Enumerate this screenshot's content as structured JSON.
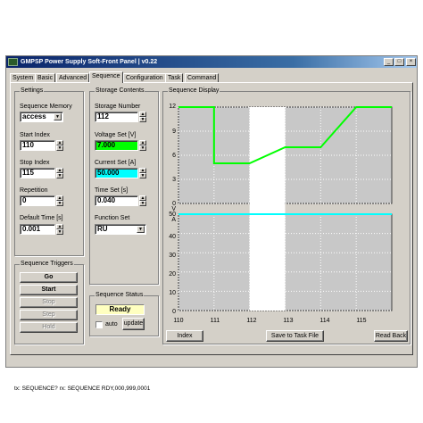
{
  "window": {
    "title": "GMPSP Power Supply Soft-Front Panel | v0.22",
    "controls": [
      "_",
      "□",
      "×"
    ]
  },
  "tabs": [
    {
      "label": "System",
      "active": false
    },
    {
      "label": "Basic",
      "active": false
    },
    {
      "label": "Advanced",
      "active": false
    },
    {
      "label": "Sequence",
      "active": true
    },
    {
      "label": "Configuration",
      "active": false
    },
    {
      "label": "Task",
      "active": false
    },
    {
      "label": "Command",
      "active": false
    }
  ],
  "settings": {
    "group_label": "Settings",
    "sequence_memory": {
      "label": "Sequence Memory",
      "value": "access"
    },
    "start_index": {
      "label": "Start Index",
      "value": "110"
    },
    "stop_index": {
      "label": "Stop Index",
      "value": "115"
    },
    "repetition": {
      "label": "Repetition",
      "value": "0"
    },
    "default_time": {
      "label": "Default Time [s]",
      "value": "0.001"
    }
  },
  "triggers": {
    "group_label": "Sequence Triggers",
    "go": "Go",
    "start": "Start",
    "stop": "Stop",
    "step": "Step",
    "hold": "Hold"
  },
  "storage": {
    "group_label": "Storage Contents",
    "storage_number": {
      "label": "Storage Number",
      "value": "112"
    },
    "voltage_set": {
      "label": "Voltage Set [V]",
      "value": "7.000",
      "color": "#00ff00"
    },
    "current_set": {
      "label": "Current Set [A]",
      "value": "50.000",
      "color": "#00ffff"
    },
    "time_set": {
      "label": "Time Set [s]",
      "value": "0.040"
    },
    "function_set": {
      "label": "Function Set",
      "value": "RU"
    }
  },
  "seq_status": {
    "group_label": "Sequence Status",
    "state": "Ready",
    "state_color": "#ffffc0",
    "auto_label": "auto",
    "auto_checked": false,
    "update_label": "update"
  },
  "display": {
    "group_label": "Sequence Display",
    "index_button": "Index",
    "save_button": "Save to Task File",
    "read_button": "Read Back"
  },
  "chart_data": {
    "type": "line",
    "x": [
      110,
      111,
      112,
      113,
      114,
      115
    ],
    "x_tick_labels": [
      "110",
      "111",
      "112",
      "113",
      "114",
      "115"
    ],
    "x_range": [
      110,
      116
    ],
    "highlight_step": [
      112,
      113
    ],
    "voltage": {
      "y_ticks": [
        "12",
        "9",
        "6",
        "3",
        "0"
      ],
      "y_range": [
        0,
        12
      ],
      "unit": "V",
      "color": "#00ff00",
      "points": [
        [
          110,
          12
        ],
        [
          111,
          12
        ],
        [
          111,
          5
        ],
        [
          112,
          5
        ],
        [
          113,
          7
        ],
        [
          114,
          7
        ],
        [
          115,
          12
        ],
        [
          116,
          12
        ]
      ]
    },
    "current": {
      "y_ticks": [
        "50",
        "40",
        "30",
        "20",
        "10",
        "0"
      ],
      "y_range": [
        0,
        50
      ],
      "unit": "A",
      "color": "#00ffff",
      "points": [
        [
          110,
          50
        ],
        [
          116,
          50
        ]
      ]
    },
    "grid": true
  },
  "status_bar": "tx: SEQUENCE?  rx: SEQUENCE  RDY,000,999,0001"
}
